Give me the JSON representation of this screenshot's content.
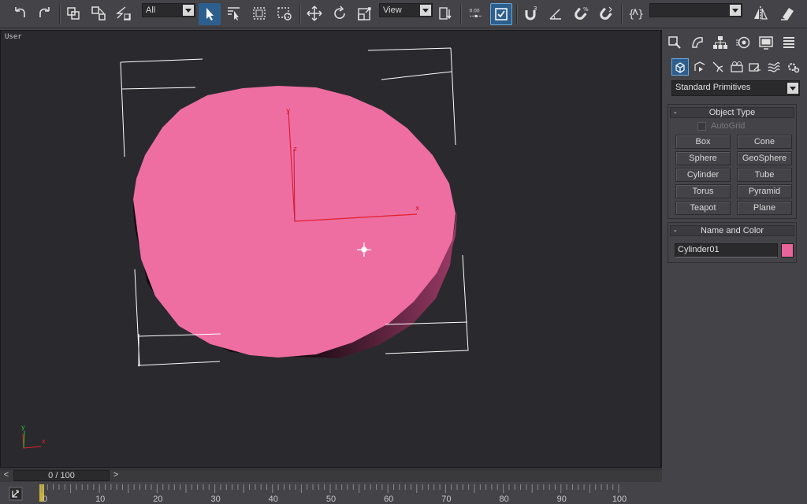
{
  "toolbar": {
    "selection_filter": "All",
    "ref_coord_system": "View",
    "spinner_value": "0.00",
    "snap_3d_label": "3",
    "named_selection": ""
  },
  "viewport": {
    "label": "User",
    "object_axis_x": "x",
    "object_axis_y": "y",
    "object_axis_z": "z",
    "world_axis_x": "x",
    "world_axis_y": "y",
    "colors": {
      "background": "#2a2a2e",
      "cylinder_top": "#ee6ea2",
      "bounding_box": "#ffffff",
      "axis_x": "#e0202a",
      "axis_y": "#e0202a"
    }
  },
  "command_panel": {
    "category": "Standard Primitives",
    "object_type": {
      "title": "Object Type",
      "collapse": "-",
      "autogrid_label": "AutoGrid",
      "buttons": [
        "Box",
        "Cone",
        "Sphere",
        "GeoSphere",
        "Cylinder",
        "Tube",
        "Torus",
        "Pyramid",
        "Teapot",
        "Plane"
      ]
    },
    "name_and_color": {
      "title": "Name and Color",
      "collapse": "-",
      "name": "Cylinder01",
      "color": "#e8649a"
    }
  },
  "timeline": {
    "frame_display": "0 / 100",
    "prev_arrow": "<",
    "next_arrow": ">",
    "ruler_labels": [
      "0",
      "10",
      "20",
      "30",
      "40",
      "50",
      "60",
      "70",
      "80",
      "90",
      "100"
    ]
  }
}
